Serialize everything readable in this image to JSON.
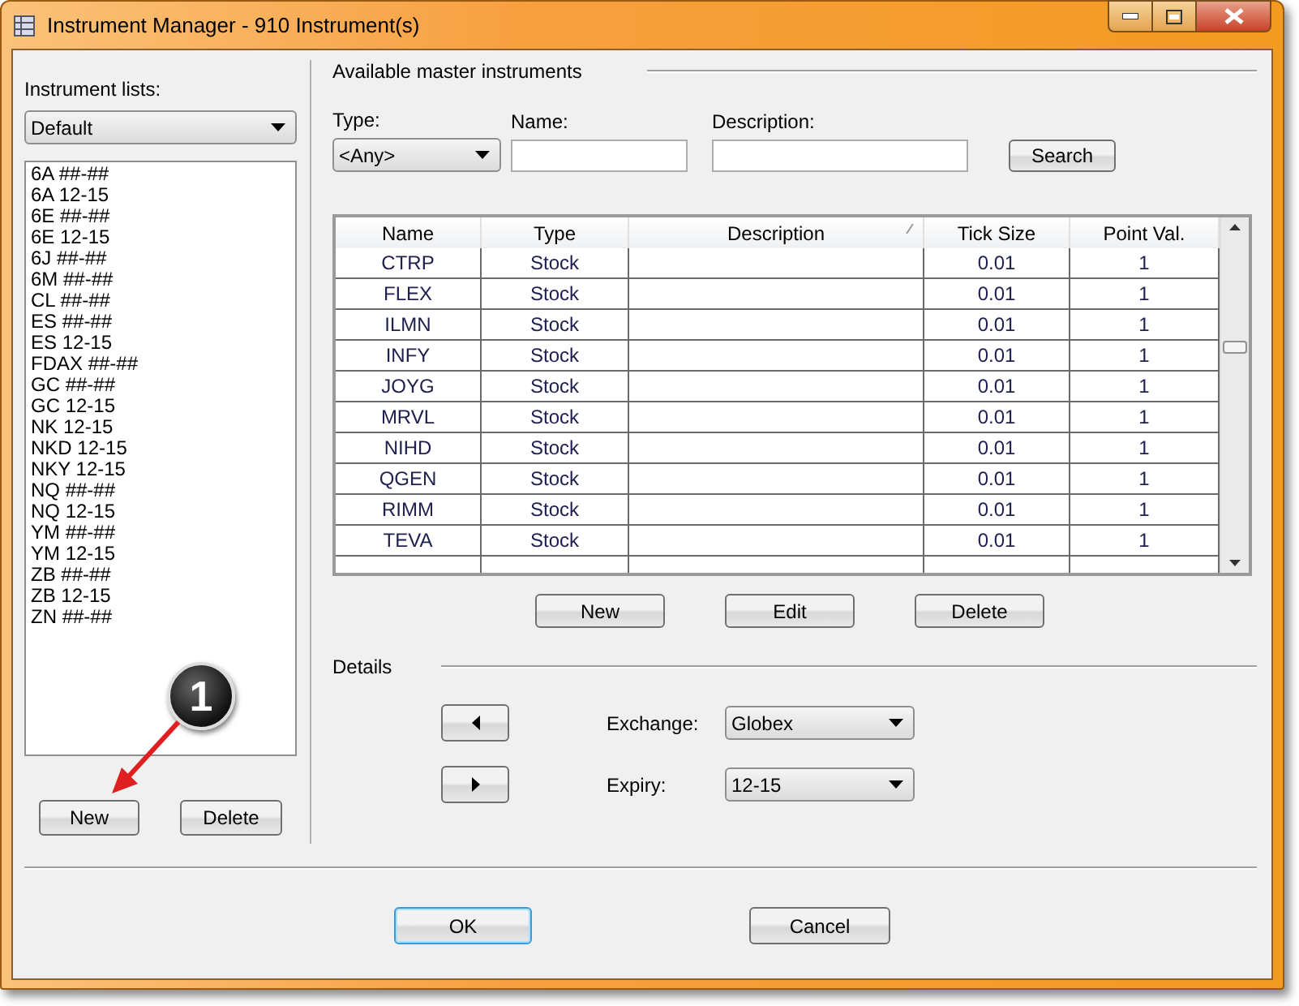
{
  "window": {
    "title": "Instrument Manager - 910 Instrument(s)"
  },
  "instrument_lists": {
    "label": "Instrument lists:",
    "dropdown": "Default",
    "items": [
      "6A ##-##",
      "6A 12-15",
      "6E ##-##",
      "6E 12-15",
      "6J ##-##",
      "6M ##-##",
      "CL ##-##",
      "ES ##-##",
      "ES 12-15",
      "FDAX ##-##",
      "GC ##-##",
      "GC 12-15",
      "NK 12-15",
      "NKD 12-15",
      "NKY 12-15",
      "NQ ##-##",
      "NQ 12-15",
      "YM ##-##",
      "YM 12-15",
      "ZB ##-##",
      "ZB 12-15",
      "ZN ##-##"
    ],
    "buttons": [
      "New",
      "Delete"
    ]
  },
  "master": {
    "title": "Available master instruments",
    "filters": [
      {
        "label": "Type:",
        "kind": "dropdown",
        "value": "<Any>"
      },
      {
        "label": "Name:",
        "kind": "text"
      },
      {
        "label": "Description:",
        "kind": "text"
      }
    ],
    "search_button": "Search",
    "table": {
      "columns": [
        "Name",
        "Type",
        "Description",
        "Tick Size",
        "Point Val."
      ],
      "rows": [
        [
          "CTRP",
          "Stock",
          "",
          "0.01",
          "1"
        ],
        [
          "FLEX",
          "Stock",
          "",
          "0.01",
          "1"
        ],
        [
          "ILMN",
          "Stock",
          "",
          "0.01",
          "1"
        ],
        [
          "INFY",
          "Stock",
          "",
          "0.01",
          "1"
        ],
        [
          "JOYG",
          "Stock",
          "",
          "0.01",
          "1"
        ],
        [
          "MRVL",
          "Stock",
          "",
          "0.01",
          "1"
        ],
        [
          "NIHD",
          "Stock",
          "",
          "0.01",
          "1"
        ],
        [
          "QGEN",
          "Stock",
          "",
          "0.01",
          "1"
        ],
        [
          "RIMM",
          "Stock",
          "",
          "0.01",
          "1"
        ],
        [
          "TEVA",
          "Stock",
          "",
          "0.01",
          "1"
        ]
      ]
    },
    "buttons": [
      "New",
      "Edit",
      "Delete"
    ]
  },
  "details": {
    "title": "Details",
    "fields": [
      {
        "label": "Exchange:",
        "value": "Globex"
      },
      {
        "label": "Expiry:",
        "value": "12-15"
      }
    ]
  },
  "footer_buttons": [
    {
      "label": "OK",
      "default": true
    },
    {
      "label": "Cancel",
      "default": false
    }
  ],
  "callout": {
    "number": "1"
  }
}
